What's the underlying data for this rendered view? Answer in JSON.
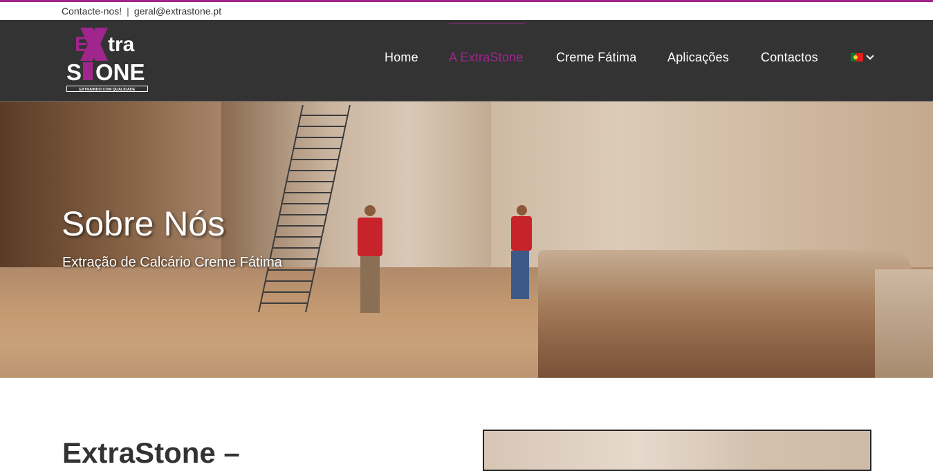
{
  "colors": {
    "accent": "#a0268e",
    "header_bg": "#333333"
  },
  "topbar": {
    "contact_label": "Contacte-nos!",
    "separator": "|",
    "email": "geral@extrastone.pt"
  },
  "logo": {
    "line1_a": "EX",
    "line1_b": "tra",
    "line2": "STONE",
    "tagline": "EXTRAINDO COM QUALIDADE"
  },
  "nav": {
    "items": [
      {
        "label": "Home"
      },
      {
        "label": "A ExtraStone",
        "active": true
      },
      {
        "label": "Creme Fátima"
      },
      {
        "label": "Aplicações"
      },
      {
        "label": "Contactos"
      }
    ],
    "language": {
      "flag_icon": "portugal-flag-icon",
      "dropdown_icon": "chevron-down-icon"
    }
  },
  "hero": {
    "title": "Sobre Nós",
    "subtitle": "Extração de Calcário Creme Fátima"
  },
  "content": {
    "title": "ExtraStone –"
  }
}
